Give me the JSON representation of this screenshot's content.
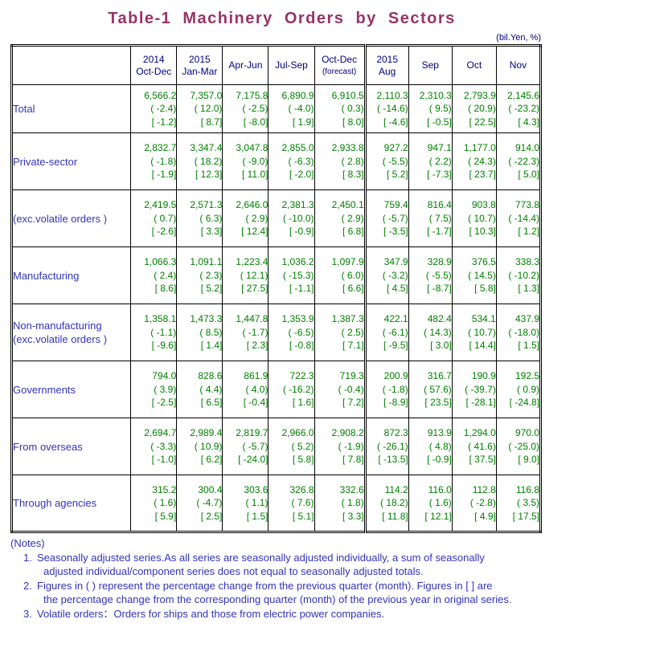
{
  "title": "Table-1  Machinery  Orders  by  Sectors",
  "unit": "(bil.Yen, %)",
  "header": {
    "blank": "",
    "columns": [
      {
        "year": "2014",
        "period": "Oct-Dec",
        "note": ""
      },
      {
        "year": "2015",
        "period": "Jan-Mar",
        "note": ""
      },
      {
        "year": "",
        "period": "Apr-Jun",
        "note": ""
      },
      {
        "year": "",
        "period": "Jul-Sep",
        "note": ""
      },
      {
        "year": "",
        "period": "Oct-Dec",
        "note": "(forecast)"
      },
      {
        "year": "2015",
        "period": "Aug",
        "note": ""
      },
      {
        "year": "",
        "period": "Sep",
        "note": ""
      },
      {
        "year": "",
        "period": "Oct",
        "note": ""
      },
      {
        "year": "",
        "period": "Nov",
        "note": ""
      }
    ]
  },
  "rows": [
    {
      "label": "Total",
      "label2": "",
      "indent": 0,
      "values": [
        "6,566.2",
        "7,357.0",
        "7,175.8",
        "6,890.9",
        "6,910.5",
        "2,110.3",
        "2,310.3",
        "2,793.9",
        "2,145.6"
      ],
      "paren": [
        "( -2.4)",
        "( 12.0)",
        "( -2.5)",
        "( -4.0)",
        "(  0.3)",
        "( -14.6)",
        "(  9.5)",
        "( 20.9)",
        "( -23.2)"
      ],
      "bracket": [
        "[ -1.2]",
        "[  8.7]",
        "[ -8.0]",
        "[  1.9]",
        "[  8.0]",
        "[ -4.6]",
        "[ -0.5]",
        "[ 22.5]",
        "[  4.3]"
      ]
    },
    {
      "label": "Private-sector",
      "label2": "",
      "indent": 1,
      "values": [
        "2,832.7",
        "3,347.4",
        "3,047.8",
        "2,855.0",
        "2,933.8",
        "927.2",
        "947.1",
        "1,177.0",
        "914.0"
      ],
      "paren": [
        "( -1.8)",
        "(  18.2)",
        "( -9.0)",
        "( -6.3)",
        "(  2.8)",
        "( -5.5)",
        "(  2.2)",
        "( 24.3)",
        "( -22.3)"
      ],
      "bracket": [
        "[ -1.9]",
        "[  12.3]",
        "[  11.0]",
        "[ -2.0]",
        "[  8.3]",
        "[  5.2]",
        "[ -7.3]",
        "[ 23.7]",
        "[  5.0]"
      ]
    },
    {
      "label": "(exc.volatile orders )",
      "label2": "",
      "indent": 1,
      "values": [
        "2,419.5",
        "2,571.3",
        "2,646.0",
        "2,381.3",
        "2,450.1",
        "759.4",
        "816.4",
        "903.8",
        "773.8"
      ],
      "paren": [
        "(  0.7)",
        "(  6.3)",
        "(  2.9)",
        "( -10.0)",
        "(  2.9)",
        "( -5.7)",
        "(  7.5)",
        "( 10.7)",
        "( -14.4)"
      ],
      "bracket": [
        "[ -2.6]",
        "[  3.3]",
        "[ 12.4]",
        "[ -0.9]",
        "[  6.8]",
        "[ -3.5]",
        "[ -1.7]",
        "[ 10.3]",
        "[  1.2]"
      ]
    },
    {
      "label": "Manufacturing",
      "label2": "",
      "indent": 2,
      "values": [
        "1,066.3",
        "1,091.1",
        "1,223.4",
        "1,036.2",
        "1,097.9",
        "347.9",
        "328.9",
        "376.5",
        "338.3"
      ],
      "paren": [
        "(  2.4)",
        "(  2.3)",
        "( 12.1)",
        "( -15.3)",
        "(  6.0)",
        "( -3.2)",
        "( -5.5)",
        "( 14.5)",
        "( -10.2)"
      ],
      "bracket": [
        "[  8.6]",
        "[  5.2]",
        "[ 27.5]",
        "[ -1.1]",
        "[  6.6]",
        "[  4.5]",
        "[ -8.7]",
        "[  5.8]",
        "[  1.3]"
      ]
    },
    {
      "label": "Non-manufacturing",
      "label2": "(exc.volatile orders )",
      "indent": 2,
      "values": [
        "1,358.1",
        "1,473.3",
        "1,447.8",
        "1,353.9",
        "1,387.3",
        "422.1",
        "482.4",
        "534.1",
        "437.9"
      ],
      "paren": [
        "( -1.1)",
        "(  8.5)",
        "( -1.7)",
        "( -6.5)",
        "(  2.5)",
        "( -6.1)",
        "( 14.3)",
        "( 10.7)",
        "( -18.0)"
      ],
      "bracket": [
        "[ -9.6]",
        "[  1.4]",
        "[  2.3]",
        "[ -0.8]",
        "[  7.1]",
        "[ -9.5]",
        "[  3.0]",
        "[ 14.4]",
        "[  1.5]"
      ]
    },
    {
      "label": "Governments",
      "label2": "",
      "indent": 1,
      "values": [
        "794.0",
        "828.6",
        "861.9",
        "722.3",
        "719.3",
        "200.9",
        "316.7",
        "190.9",
        "192.5"
      ],
      "paren": [
        "(  3.9)",
        "(  4.4)",
        "(  4.0)",
        "( -16.2)",
        "( -0.4)",
        "( -1.8)",
        "( 57.6)",
        "( -39.7)",
        "(  0.9)"
      ],
      "bracket": [
        "[ -2.5]",
        "[  6.5]",
        "[ -0.4]",
        "[  1.6]",
        "[  7.2]",
        "[ -8.9]",
        "[ 23.5]",
        "[ -28.1]",
        "[ -24.8]"
      ]
    },
    {
      "label": "From overseas",
      "label2": "",
      "indent": 1,
      "values": [
        "2,694.7",
        "2,989.4",
        "2,819.7",
        "2,966.0",
        "2,908.2",
        "872.3",
        "913.9",
        "1,294.0",
        "970.0"
      ],
      "paren": [
        "( -3.3)",
        "( 10.9)",
        "( -5.7)",
        "(  5.2)",
        "( -1.9)",
        "( -26.1)",
        "(  4.8)",
        "( 41.6)",
        "( -25.0)"
      ],
      "bracket": [
        "[ -1.0]",
        "[  6.2]",
        "[ -24.0]",
        "[  5.8]",
        "[  7.8]",
        "[ -13.5]",
        "[ -0.9]",
        "[ 37.5]",
        "[  9.0]"
      ]
    },
    {
      "label": "Through agencies",
      "label2": "",
      "indent": 1,
      "values": [
        "315.2",
        "300.4",
        "303.6",
        "326.8",
        "332.6",
        "114.2",
        "116.0",
        "112.8",
        "116.8"
      ],
      "paren": [
        "(  1.6)",
        "( -4.7)",
        "(  1.1)",
        "(  7.6)",
        "(  1.8)",
        "( 18.2)",
        "(  1.6)",
        "( -2.8)",
        "(  3.5)"
      ],
      "bracket": [
        "[  5.9]",
        "[  2.5]",
        "[  1.5]",
        "[  5.1]",
        "[  3.3]",
        "[ 11.8]",
        "[ 12.1]",
        "[  4.9]",
        "[ 17.5]"
      ]
    }
  ],
  "notes": {
    "heading": "(Notes)",
    "items": [
      {
        "num": "1.",
        "line1": "Seasonally adjusted series.As all series are seasonally adjusted individually, a sum of seasonally",
        "line2": "adjusted individual/component series does not equal to seasonally adjusted totals."
      },
      {
        "num": "2.",
        "line1": "Figures in ( ) represent the percentage change from the previous quarter (month). Figures in [ ] are",
        "line2": "the percentage change from the corresponding quarter (month) of the previous year in original series."
      },
      {
        "num": "3.",
        "line1": "Volatile orders：Orders for ships and those from electric power companies.",
        "line2": ""
      }
    ]
  },
  "colors": {
    "title": "#993366",
    "label": "#3333BB",
    "value": "#008000",
    "header": "#000080"
  }
}
